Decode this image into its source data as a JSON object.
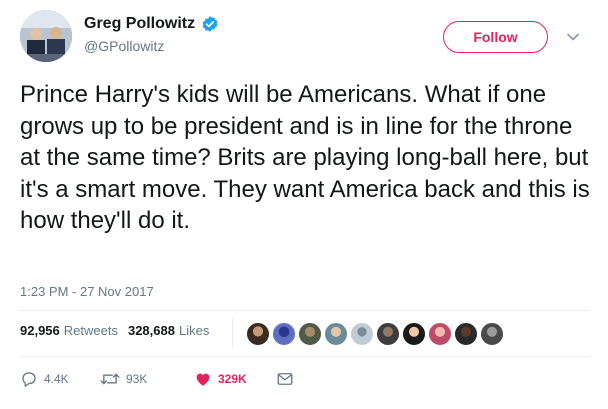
{
  "author": {
    "display_name": "Greg Pollowitz",
    "handle": "@GPollowitz",
    "verified": true
  },
  "follow_button": {
    "label": "Follow"
  },
  "tweet": {
    "text": "Prince Harry's kids will be Americans. What if one grows up to be president and is in line for the throne at the same time? Brits are playing long-ball here, but it's a smart move. They want America back and this is how they'll do it.",
    "timestamp": "1:23 PM - 27 Nov 2017"
  },
  "stats": {
    "retweets_count": "92,956",
    "retweets_label": "Retweets",
    "likes_count": "328,688",
    "likes_label": "Likes"
  },
  "actions": {
    "reply_count": "4.4K",
    "retweet_count": "93K",
    "like_count": "329K"
  },
  "colors": {
    "like_accent": "#e0245e",
    "verified_blue": "#1da1f2",
    "muted_text": "#657786"
  },
  "icons": {
    "verified": "verified-badge-icon",
    "caret": "chevron-down-icon",
    "reply": "reply-icon",
    "retweet": "retweet-icon",
    "like": "heart-icon",
    "message": "envelope-icon"
  }
}
